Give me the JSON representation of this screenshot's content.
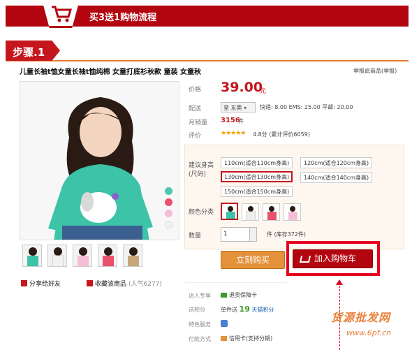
{
  "banner": {
    "title": "买3送1购物流程"
  },
  "step": {
    "label": "步骤.1"
  },
  "product": {
    "title": "儿童长袖t恤女童长袖t恤纯棉 女童打底衫秋款 童装 女童秋",
    "report": "举报此商品(举报)"
  },
  "info": {
    "price_label": "价格",
    "price": "39.00",
    "price_unit": "元",
    "shipping_label": "配送",
    "shipping_to": "至 东莞",
    "shipping_text": "快递: 8.00 EMS: 25.00 平邮: 20.00",
    "sales_label": "月销量",
    "sales": "3156",
    "sales_unit": "件",
    "rating_label": "评价",
    "stars": "★★★★★",
    "rating_text": "4.8分 (累计评价6059)"
  },
  "sku": {
    "size_label_1": "建议身高",
    "size_label_2": "(尺码)",
    "sizes": [
      "110cm(适合110cm身高)",
      "120cm(适合120cm身高)",
      "130cm(适合130cm身高)",
      "140cm(适合140cm身高)",
      "150cm(适合150cm身高)"
    ],
    "selected_size_index": 2,
    "color_label": "颜色分类",
    "selected_color_index": 0,
    "qty_label": "数量",
    "qty": "1",
    "qty_unit": "件",
    "stock": "(库存372件)"
  },
  "actions": {
    "buy_now": "立刻购买",
    "add_to_cart": "加入购物车"
  },
  "share": {
    "share_label": "分享给好友",
    "fav_label": "收藏该商品",
    "popularity": "(人气6277)"
  },
  "services": {
    "expert_label": "达人专享",
    "expert_value": "退货保障卡",
    "points_label": "送积分",
    "points_prefix": "单件送",
    "points_value": "19",
    "points_suffix": "天猫积分",
    "special_label": "特色服务",
    "payment_label": "付款方式",
    "payment_value": "信用卡(支持分期)"
  },
  "watermark": {
    "cn": "货源批发网",
    "url": "www.6pf.cn"
  },
  "colors": {
    "brand_red": "#b3050f",
    "price_red": "#c5161d",
    "highlight_red": "#e6001f",
    "buy_orange": "#e4913b",
    "dot_teal": "#4cc7b4",
    "dot_red": "#e8506c",
    "dot_pink": "#f4bfd6"
  }
}
